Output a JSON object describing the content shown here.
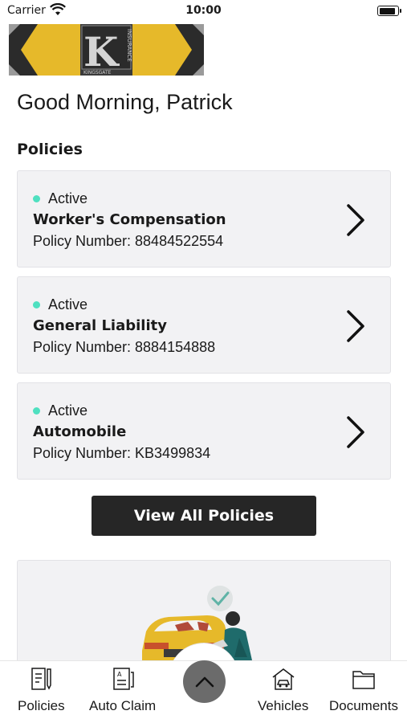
{
  "status_bar": {
    "carrier": "Carrier",
    "time": "10:00"
  },
  "logo": {
    "letter": "K",
    "vertical_text": "INSURANCE",
    "sub_text": "KINGSGATE"
  },
  "greeting": "Good Morning, Patrick",
  "policies_section": {
    "title": "Policies",
    "items": [
      {
        "status": "Active",
        "name": "Worker's Compensation",
        "number": "Policy Number: 88484522554"
      },
      {
        "status": "Active",
        "name": "General Liability",
        "number": "Policy Number: 8884154888"
      },
      {
        "status": "Active",
        "name": "Automobile",
        "number": "Policy Number: KB3499834"
      }
    ],
    "view_all_label": "View All Policies"
  },
  "tab_bar": {
    "tabs": [
      {
        "label": "Policies",
        "icon": "policy-document-icon"
      },
      {
        "label": "Auto Claim",
        "icon": "claim-form-icon"
      },
      {
        "label": "Vehicles",
        "icon": "car-garage-icon"
      },
      {
        "label": "Documents",
        "icon": "folder-icon"
      }
    ],
    "center_icon": "chevron-up-icon"
  },
  "colors": {
    "active_dot": "#4fe0c0",
    "logo_gold": "#e6b92a",
    "button_dark": "#262626",
    "card_bg": "#f2f2f4",
    "center_button": "#6b6b6b"
  }
}
